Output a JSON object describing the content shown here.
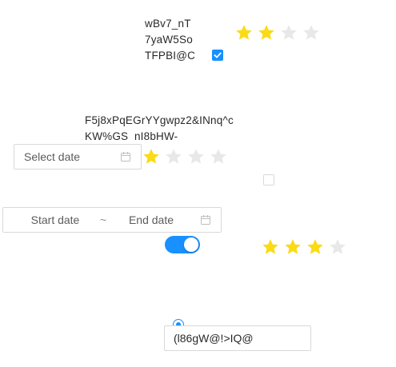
{
  "colors": {
    "primary": "#1890ff",
    "star_on": "#fadb14",
    "star_off": "#e8e8e8",
    "border": "#d9d9d9"
  },
  "text_block_1": {
    "lines": [
      "wBv7_nT",
      "7yaW5So",
      "TFPBI@C"
    ]
  },
  "rating_1": {
    "value": 2,
    "max": 4
  },
  "checkbox_1": {
    "checked": true
  },
  "text_block_2": {
    "lines": [
      "F5j8xPqEGrYYgwpz2&INnq^c",
      "KW%GS_nI8bHW-"
    ]
  },
  "date_picker": {
    "placeholder": "Select date",
    "icon": "calendar-icon"
  },
  "rating_2": {
    "value": 1,
    "max": 4
  },
  "checkbox_2": {
    "checked": false
  },
  "range_picker": {
    "start_placeholder": "Start date",
    "separator": "~",
    "end_placeholder": "End date",
    "icon": "calendar-icon"
  },
  "switch_1": {
    "on": true
  },
  "rating_3": {
    "value": 3,
    "max": 4
  },
  "radio_1": {
    "checked": true
  },
  "text_input_1": {
    "value": "(l86gW@!>IQ@"
  }
}
